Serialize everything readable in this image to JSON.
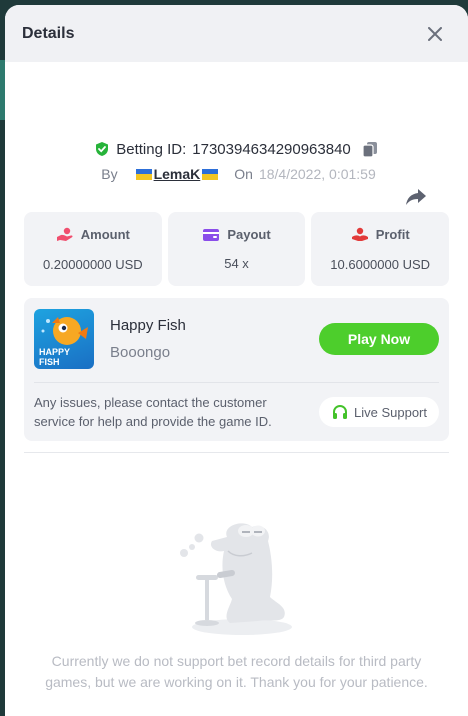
{
  "header": {
    "title": "Details"
  },
  "bet": {
    "id_label": "Betting ID:",
    "id_value": "1730394634290963840",
    "by_label": "By",
    "user": "LemaK",
    "on_label": "On",
    "date": "18/4/2022, 0:01:59"
  },
  "stats": [
    {
      "label": "Amount",
      "value": "0.20000000 USD",
      "icon": "hand-coins-icon"
    },
    {
      "label": "Payout",
      "value": "54 x",
      "icon": "wallet-icon"
    },
    {
      "label": "Profit",
      "value": "10.6000000 USD",
      "icon": "hand-coin-icon"
    }
  ],
  "game": {
    "name": "Happy Fish",
    "provider": "Booongo",
    "thumb_text_1": "HAPPY",
    "thumb_text_2": "FISH",
    "play_label": "Play Now",
    "issue_text": "Any issues, please contact the customer service for help and provide the game ID.",
    "support_label": "Live Support"
  },
  "empty": {
    "message": "Currently we do not support bet record details for third party games, but we are working on it. Thank you for your patience."
  },
  "colors": {
    "accent_green": "#4dce2c",
    "amount_icon": "#f04e6e",
    "payout_icon": "#8a4dea",
    "profit_icon": "#e23a3a",
    "verified": "#27b33a"
  }
}
